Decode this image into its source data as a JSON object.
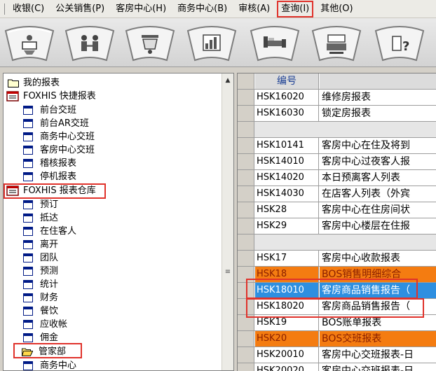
{
  "menu": {
    "items": [
      {
        "label": "收银(C)"
      },
      {
        "label": "公关销售(P)"
      },
      {
        "label": "客房中心(H)"
      },
      {
        "label": "商务中心(B)"
      },
      {
        "label": "审核(A)"
      },
      {
        "label": "查询(I)",
        "highlighted": true
      },
      {
        "label": "其他(O)"
      }
    ]
  },
  "toolbar": {
    "buttons": [
      {
        "icon": "reception-icon"
      },
      {
        "icon": "people-icon"
      },
      {
        "icon": "service-bell-icon"
      },
      {
        "icon": "report-icon"
      },
      {
        "icon": "bed-icon"
      },
      {
        "icon": "cashier-icon"
      },
      {
        "icon": "help-icon"
      }
    ]
  },
  "tree": {
    "items": [
      {
        "label": "我的报表",
        "icon": "folder-icon",
        "level": 0
      },
      {
        "label": "FOXHIS 快捷报表",
        "icon": "report-book-icon",
        "level": 0
      },
      {
        "label": "前台交班",
        "icon": "document-icon",
        "level": 1
      },
      {
        "label": "前台AR交班",
        "icon": "document-icon",
        "level": 1
      },
      {
        "label": "商务中心交班",
        "icon": "document-icon",
        "level": 1
      },
      {
        "label": "客房中心交班",
        "icon": "document-icon",
        "level": 1
      },
      {
        "label": "稽核报表",
        "icon": "document-icon",
        "level": 1
      },
      {
        "label": "停机报表",
        "icon": "document-icon",
        "level": 1
      },
      {
        "label": "FOXHIS 报表仓库",
        "icon": "report-book-icon",
        "level": 0,
        "highlighted": true
      },
      {
        "label": "预订",
        "icon": "document-icon",
        "level": 1
      },
      {
        "label": "抵达",
        "icon": "document-icon",
        "level": 1
      },
      {
        "label": "在住客人",
        "icon": "document-icon",
        "level": 1
      },
      {
        "label": "离开",
        "icon": "document-icon",
        "level": 1
      },
      {
        "label": "团队",
        "icon": "document-icon",
        "level": 1
      },
      {
        "label": "预测",
        "icon": "document-icon",
        "level": 1
      },
      {
        "label": "统计",
        "icon": "document-icon",
        "level": 1
      },
      {
        "label": "财务",
        "icon": "document-icon",
        "level": 1
      },
      {
        "label": "餐饮",
        "icon": "document-icon",
        "level": 1
      },
      {
        "label": "应收帐",
        "icon": "document-icon",
        "level": 1
      },
      {
        "label": "佣金",
        "icon": "document-icon",
        "level": 1
      },
      {
        "label": "管家部",
        "icon": "open-folder-icon",
        "level": 1,
        "highlighted": true
      },
      {
        "label": "商务中心",
        "icon": "document-icon",
        "level": 1
      }
    ]
  },
  "grid": {
    "header": {
      "code": "编号",
      "name": ""
    },
    "rows": [
      {
        "code": "HSK16020",
        "name": "维修房报表",
        "style": "normal"
      },
      {
        "code": "HSK16030",
        "name": "锁定房报表",
        "style": "normal"
      },
      {
        "code": "",
        "name": "",
        "style": "separator"
      },
      {
        "code": "HSK10141",
        "name": "客房中心在住及将到",
        "style": "normal"
      },
      {
        "code": "HSK14010",
        "name": "客房中心过夜客人报",
        "style": "normal"
      },
      {
        "code": "HSK14020",
        "name": "本日预离客人列表",
        "style": "normal"
      },
      {
        "code": "HSK14030",
        "name": "在店客人列表（外宾",
        "style": "normal"
      },
      {
        "code": "HSK28",
        "name": "客房中心在住房间状",
        "style": "normal"
      },
      {
        "code": "HSK29",
        "name": "客房中心楼层在住报",
        "style": "normal"
      },
      {
        "code": "",
        "name": "",
        "style": "separator"
      },
      {
        "code": "HSK17",
        "name": "客房中心收款报表",
        "style": "normal"
      },
      {
        "code": "HSK18",
        "name": "BOS销售明细综合",
        "style": "orange"
      },
      {
        "code": "HSK18010",
        "name": "客房商品销售报告（",
        "style": "blue",
        "highlighted": true
      },
      {
        "code": "HSK18020",
        "name": "客房商品销售报告（",
        "style": "normal",
        "highlighted": true
      },
      {
        "code": "HSK19",
        "name": "BOS账单报表",
        "style": "normal"
      },
      {
        "code": "HSK20",
        "name": "BOS交班报表",
        "style": "orange"
      },
      {
        "code": "HSK20010",
        "name": "客房中心交班报表-日",
        "style": "normal"
      },
      {
        "code": "HSK20020",
        "name": "客房中心交班报表-日",
        "style": "normal"
      }
    ]
  },
  "colors": {
    "highlight_box": "#e0322b",
    "orange_row": "#f47c11",
    "selected_row": "#2e8fe0",
    "grid_header_text": "#1b3f94"
  }
}
